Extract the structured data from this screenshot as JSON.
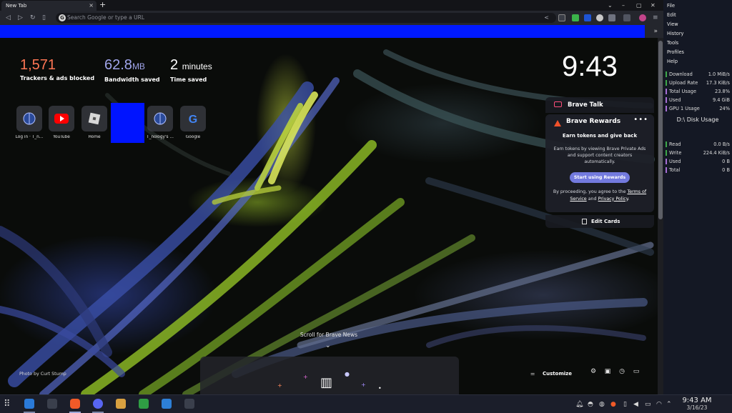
{
  "browser": {
    "tab_title": "New Tab",
    "tab_close": "×",
    "new_tab": "+",
    "window_controls": [
      "⌄",
      "–",
      "▢",
      "✕"
    ],
    "omnibox_placeholder": "Search Google or type a URL",
    "bookmarks_more": "»"
  },
  "stats": [
    {
      "value": "1,571",
      "unit": "",
      "label": "Trackers & ads blocked",
      "color": "#ff7654"
    },
    {
      "value": "62.8",
      "unit": "MB",
      "label": "Bandwidth saved",
      "color": "#a0a5eb"
    },
    {
      "value": "2",
      "unit": "minutes",
      "label": "Time saved",
      "color": "#ffffff"
    }
  ],
  "clock": "9:43",
  "top_sites": [
    {
      "label": "Log in · T_n...",
      "icon": "globe-icon"
    },
    {
      "label": "YouTube",
      "icon": "youtube-icon"
    },
    {
      "label": "Home",
      "icon": "roblox-icon"
    },
    {
      "label": "T_nology's ...",
      "icon": "globe-icon"
    },
    {
      "label": "Google",
      "icon": "google-icon"
    }
  ],
  "brave_talk": {
    "title": "Brave Talk"
  },
  "brave_rewards": {
    "title": "Brave Rewards",
    "menu": "•••",
    "heading": "Earn tokens and give back",
    "body": "Earn tokens by viewing Brave Private Ads and support content creators automatically.",
    "button": "Start using Rewards",
    "footer_prefix": "By proceeding, you agree to the",
    "terms": "Terms of Service",
    "and": "and",
    "privacy": "Privacy Policy",
    "period": "."
  },
  "edit_cards": "Edit Cards",
  "scroll_news": "Scroll for Brave News",
  "photo_credit": {
    "prefix": "Photo by",
    "author": "Curt Stump"
  },
  "customize": "Customize",
  "sidebar": {
    "menu": [
      "File",
      "Edit",
      "View",
      "History",
      "Tools",
      "Profiles",
      "Help"
    ],
    "monitor": [
      {
        "k": "Download",
        "v": "1.0 MiB/s",
        "color": "#3ea84a"
      },
      {
        "k": "Upload Rate",
        "v": "17.3 KiB/s",
        "color": "#3ea84a"
      },
      {
        "k": "Total Usage",
        "v": "23.8%",
        "color": "#a86fd8"
      },
      {
        "k": "Used",
        "v": "9.4 GiB",
        "color": "#a86fd8"
      },
      {
        "k": "GPU 1 Usage",
        "v": "24%",
        "color": "#a86fd8"
      }
    ],
    "disk_title": "D:\\ Disk Usage",
    "disk": [
      {
        "k": "Read",
        "v": "0.0 B/s",
        "color": "#3ea84a"
      },
      {
        "k": "Write",
        "v": "224.4 KiB/s",
        "color": "#3ea84a"
      },
      {
        "k": "Used",
        "v": "0 B",
        "color": "#a86fd8"
      },
      {
        "k": "Total",
        "v": "0 B",
        "color": "#a86fd8"
      }
    ]
  },
  "taskbar": {
    "time": "9:43 AM",
    "date": "3/16/23"
  }
}
